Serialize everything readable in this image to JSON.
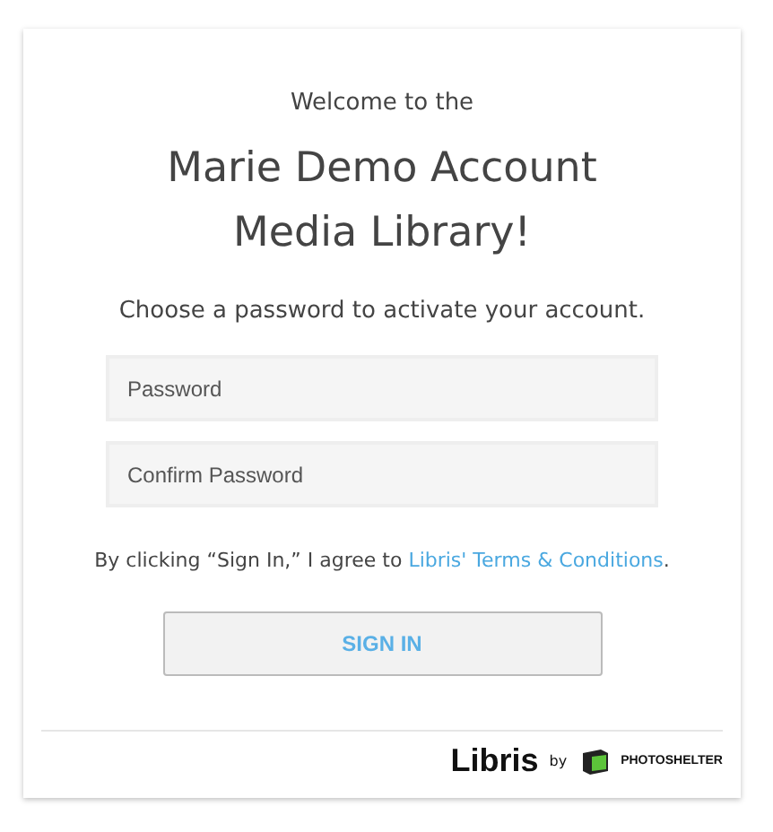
{
  "welcome": "Welcome to the",
  "title": "Marie Demo Account Media Library!",
  "instruction": "Choose a password to activate your account.",
  "fields": [
    {
      "placeholder": "Password"
    },
    {
      "placeholder": "Confirm Password"
    }
  ],
  "agreement": {
    "text": "By clicking “Sign In,” I agree to ",
    "link": "Libris' Terms & Conditions",
    "after": "."
  },
  "button": "SIGN IN",
  "footer": {
    "brand": "Libris",
    "by": "by",
    "partner": "PHOTOSHELTER"
  }
}
